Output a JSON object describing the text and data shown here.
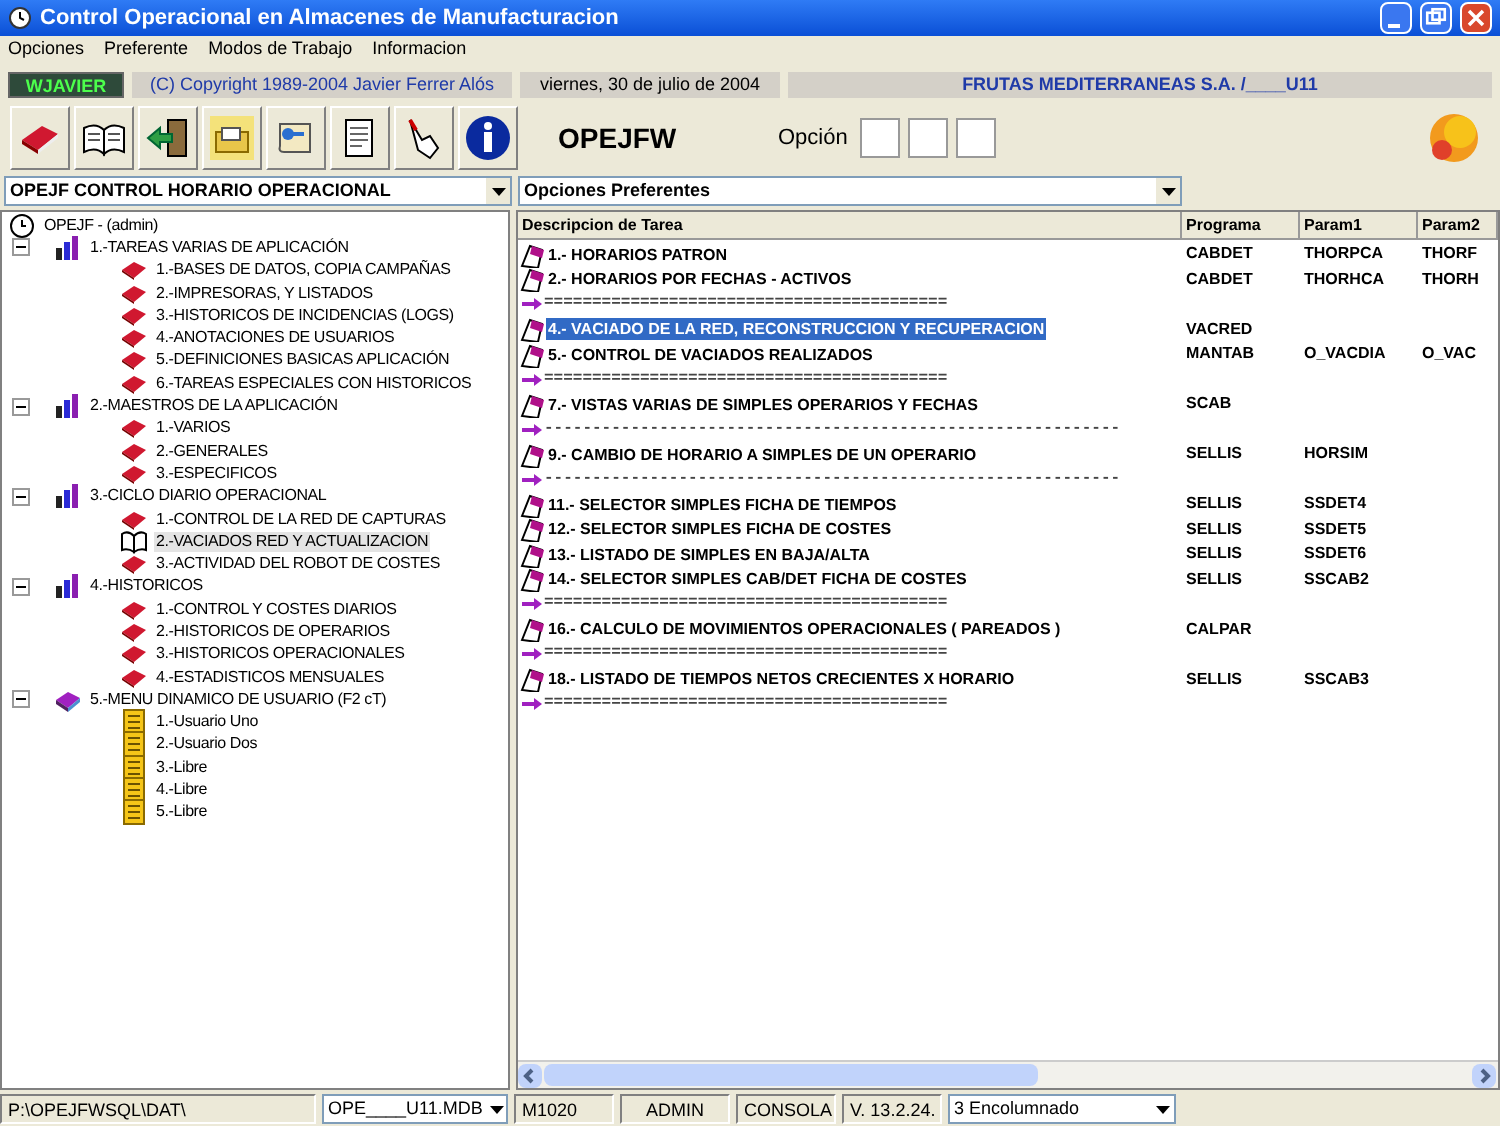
{
  "window": {
    "title": "Control Operacional en Almacenes de Manufacturacion"
  },
  "menu": [
    "Opciones",
    "Preferente",
    "Modos de Trabajo",
    "Informacion"
  ],
  "info_bar": {
    "user": "WJAVIER",
    "copyright": "(C) Copyright 1989-2004 Javier Ferrer Alós",
    "date": "viernes, 30 de julio de 2004",
    "company": "FRUTAS MEDITERRANEAS S.A. /____U11"
  },
  "toolbar": {
    "buttons": [
      {
        "kind": "book"
      },
      {
        "kind": "open-book"
      },
      {
        "kind": "exit"
      },
      {
        "kind": "folder"
      },
      {
        "kind": "map"
      },
      {
        "kind": "document"
      },
      {
        "kind": "hand"
      },
      {
        "kind": "info"
      }
    ],
    "program": "OPEJFW",
    "option_label": "Opción"
  },
  "left_dropdown": {
    "value": "OPEJF CONTROL HORARIO OPERACIONAL"
  },
  "right_dropdown": {
    "value": "Opciones Preferentes"
  },
  "tree": {
    "root": "OPEJF - (admin)",
    "children": [
      {
        "label": "1.-TAREAS VARIAS DE APLICACIÓN",
        "kind": "group",
        "expanded": true,
        "children": [
          {
            "label": "1.-BASES DE DATOS, COPIA CAMPAÑAS",
            "kind": "task",
            "selected": false
          },
          {
            "label": "2.-IMPRESORAS, Y LISTADOS",
            "kind": "task",
            "selected": false
          },
          {
            "label": "3.-HISTORICOS DE INCIDENCIAS (LOGS)",
            "kind": "task",
            "selected": false
          },
          {
            "label": "4.-ANOTACIONES DE USUARIOS",
            "kind": "task",
            "selected": false
          },
          {
            "label": "5.-DEFINICIONES BASICAS APLICACIÓN",
            "kind": "task",
            "selected": false
          },
          {
            "label": "6.-TAREAS ESPECIALES CON HISTORICOS",
            "kind": "task",
            "selected": false
          }
        ]
      },
      {
        "label": "2.-MAESTROS DE LA APLICACIÓN",
        "kind": "group",
        "expanded": true,
        "children": [
          {
            "label": "1.-VARIOS",
            "kind": "task",
            "selected": false
          },
          {
            "label": "2.-GENERALES",
            "kind": "task",
            "selected": false
          },
          {
            "label": "3.-ESPECIFICOS",
            "kind": "task",
            "selected": false
          }
        ]
      },
      {
        "label": "3.-CICLO DIARIO OPERACIONAL",
        "kind": "group",
        "expanded": true,
        "children": [
          {
            "label": "1.-CONTROL DE LA RED DE CAPTURAS",
            "kind": "task",
            "selected": false
          },
          {
            "label": "2.-VACIADOS RED Y ACTUALIZACION",
            "kind": "task",
            "selected": true
          },
          {
            "label": "3.-ACTIVIDAD DEL ROBOT DE COSTES",
            "kind": "task",
            "selected": false
          }
        ]
      },
      {
        "label": "4.-HISTORICOS",
        "kind": "group",
        "expanded": true,
        "children": [
          {
            "label": "1.-CONTROL Y COSTES DIARIOS",
            "kind": "task",
            "selected": false
          },
          {
            "label": "2.-HISTORICOS DE OPERARIOS",
            "kind": "task",
            "selected": false
          },
          {
            "label": "3.-HISTORICOS OPERACIONALES",
            "kind": "task",
            "selected": false
          },
          {
            "label": "4.-ESTADISTICOS MENSUALES",
            "kind": "task",
            "selected": false
          }
        ]
      },
      {
        "label": "5.-MENU DINAMICO DE USUARIO (F2 cT)",
        "kind": "user-menu",
        "expanded": true,
        "children": [
          {
            "label": "1.-Usuario Uno",
            "kind": "note",
            "selected": false
          },
          {
            "label": "2.-Usuario Dos",
            "kind": "note",
            "selected": false
          },
          {
            "label": "3.-Libre",
            "kind": "note",
            "selected": false
          },
          {
            "label": "4.-Libre",
            "kind": "note",
            "selected": false
          },
          {
            "label": "5.-Libre",
            "kind": "note",
            "selected": false
          }
        ]
      }
    ]
  },
  "table": {
    "columns": [
      "Descripcion de Tarea",
      "Programa",
      "Param1",
      "Param2"
    ],
    "rows": [
      {
        "kind": "task",
        "selected": false,
        "cells": [
          "1.- HORARIOS PATRON",
          "CABDET",
          "THORPCA",
          "THORF"
        ]
      },
      {
        "kind": "task",
        "selected": false,
        "cells": [
          "2.- HORARIOS POR FECHAS - ACTIVOS",
          "CABDET",
          "THORHCA",
          "THORH"
        ]
      },
      {
        "kind": "separator",
        "text": "=========================================="
      },
      {
        "kind": "task",
        "selected": true,
        "cells": [
          "4.- VACIADO DE LA RED, RECONSTRUCCION Y RECUPERACION",
          "VACRED"
        ]
      },
      {
        "kind": "task",
        "selected": false,
        "cells": [
          "5.- CONTROL DE VACIADOS REALIZADOS",
          "MANTAB",
          "O_VACDIA",
          "O_VAC"
        ]
      },
      {
        "kind": "separator",
        "text": "=========================================="
      },
      {
        "kind": "task",
        "selected": false,
        "cells": [
          "7.- VISTAS VARIAS DE SIMPLES OPERARIOS Y FECHAS",
          "SCAB"
        ]
      },
      {
        "kind": "separator",
        "text": "------------------------------------------------------------"
      },
      {
        "kind": "task",
        "selected": false,
        "cells": [
          "9.- CAMBIO DE HORARIO A SIMPLES DE UN OPERARIO",
          "SELLIS",
          "HORSIM"
        ]
      },
      {
        "kind": "separator",
        "text": "------------------------------------------------------------"
      },
      {
        "kind": "task",
        "selected": false,
        "cells": [
          "11.- SELECTOR SIMPLES FICHA DE TIEMPOS",
          "SELLIS",
          "SSDET4"
        ]
      },
      {
        "kind": "task",
        "selected": false,
        "cells": [
          "12.- SELECTOR SIMPLES FICHA DE COSTES",
          "SELLIS",
          "SSDET5"
        ]
      },
      {
        "kind": "task",
        "selected": false,
        "cells": [
          "13.- LISTADO DE SIMPLES EN BAJA/ALTA",
          "SELLIS",
          "SSDET6"
        ]
      },
      {
        "kind": "task",
        "selected": false,
        "cells": [
          "14.- SELECTOR SIMPLES CAB/DET FICHA DE COSTES",
          "SELLIS",
          "SSCAB2"
        ]
      },
      {
        "kind": "separator",
        "text": "=========================================="
      },
      {
        "kind": "task",
        "selected": false,
        "cells": [
          "16.- CALCULO DE MOVIMIENTOS OPERACIONALES ( PAREADOS )",
          "CALPAR"
        ]
      },
      {
        "kind": "separator",
        "text": "=========================================="
      },
      {
        "kind": "task",
        "selected": false,
        "cells": [
          "18.- LISTADO DE TIEMPOS NETOS CRECIENTES X HORARIO",
          "SELLIS",
          "SSCAB3"
        ]
      },
      {
        "kind": "separator",
        "text": "=========================================="
      }
    ]
  },
  "status_bar": {
    "path": "P:\\OPEJFWSQL\\DAT\\",
    "database": "OPE____U11.MDB",
    "code": "M1020",
    "user": "ADMIN",
    "mode": "CONSOLA",
    "version": "V. 13.2.24.",
    "view": "3 Encolumnado"
  }
}
